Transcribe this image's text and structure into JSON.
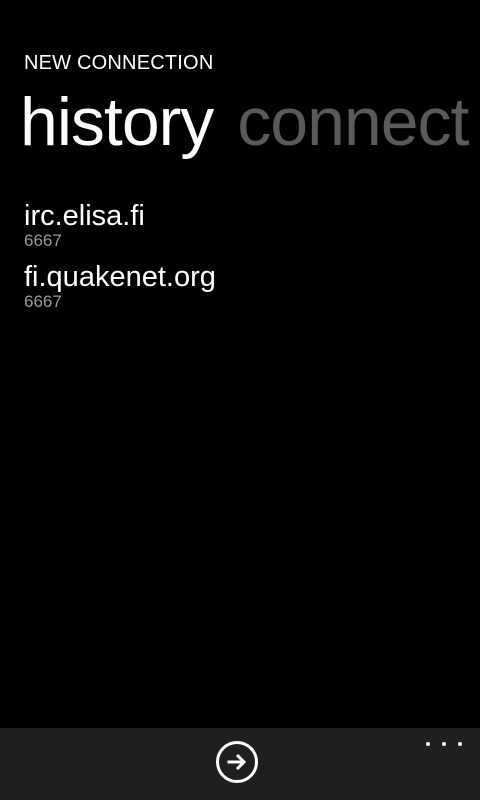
{
  "app": {
    "title": "NEW CONNECTION"
  },
  "pivot": {
    "items": [
      {
        "label": "history",
        "active": true
      },
      {
        "label": "connect",
        "active": false
      }
    ]
  },
  "history": {
    "items": [
      {
        "server": "irc.elisa.fi",
        "port": "6667"
      },
      {
        "server": "fi.quakenet.org",
        "port": "6667"
      }
    ]
  },
  "app_bar": {
    "primary_icon": "arrow-right-circle-icon",
    "more_icon": "ellipsis-icon"
  },
  "colors": {
    "background": "#000000",
    "app_bar": "#1f1f1f",
    "inactive_pivot": "#5a5a5a",
    "secondary_text": "#9a9a9a"
  }
}
